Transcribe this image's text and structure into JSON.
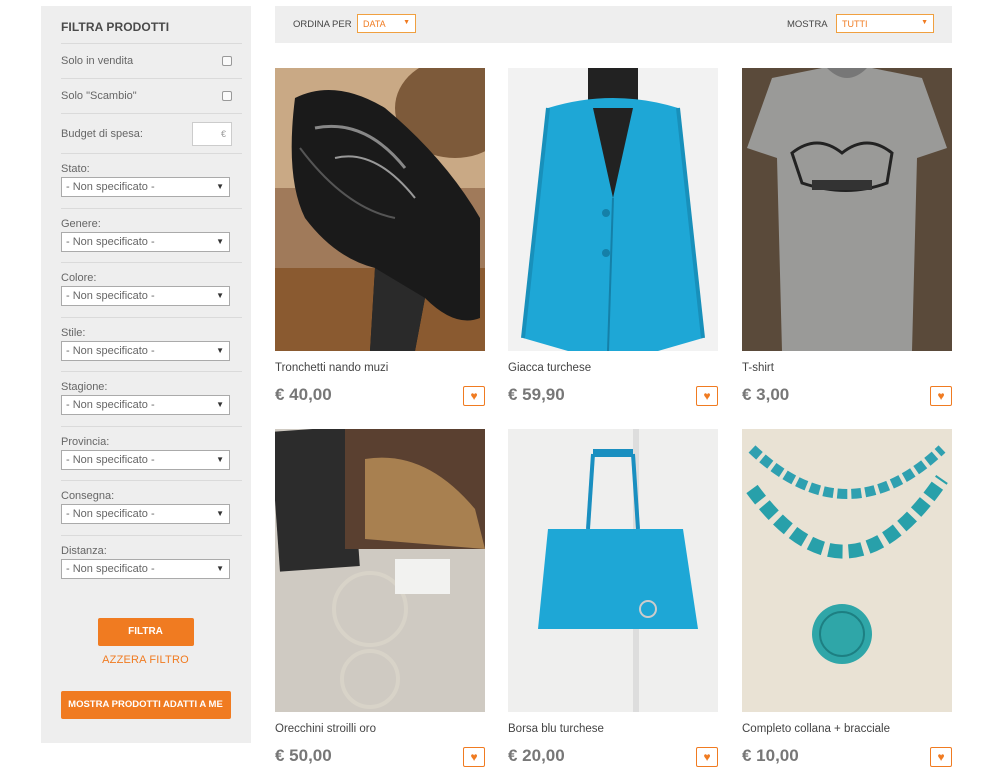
{
  "sidebar": {
    "title": "FILTRA PRODOTTI",
    "only_on_sale": "Solo in vendita",
    "only_swap": "Solo \"Scambio\"",
    "budget_label": "Budget di spesa:",
    "budget_placeholder": "€",
    "filters": [
      {
        "label": "Stato:",
        "value": "- Non specificato -"
      },
      {
        "label": "Genere:",
        "value": "- Non specificato -"
      },
      {
        "label": "Colore:",
        "value": "- Non specificato -"
      },
      {
        "label": "Stile:",
        "value": "- Non specificato -"
      },
      {
        "label": "Stagione:",
        "value": "- Non specificato -"
      },
      {
        "label": "Provincia:",
        "value": "- Non specificato -"
      },
      {
        "label": "Consegna:",
        "value": "- Non specificato -"
      },
      {
        "label": "Distanza:",
        "value": "- Non specificato -"
      }
    ],
    "filter_button": "FILTRA",
    "reset_link": "AZZERA FILTRO",
    "show_matching_button": "MOSTRA PRODOTTI ADATTI A ME"
  },
  "topbar": {
    "sort_label": "ORDINA PER",
    "sort_value": "DATA",
    "show_label": "MOSTRA",
    "show_value": "TUTTI"
  },
  "products": [
    {
      "name": "Tronchetti nando muzi",
      "price": "€ 40,00"
    },
    {
      "name": "Giacca turchese",
      "price": "€ 59,90"
    },
    {
      "name": "T-shirt",
      "price": "€ 3,00"
    },
    {
      "name": "Orecchini stroilli oro",
      "price": "€ 50,00"
    },
    {
      "name": "Borsa blu turchese",
      "price": "€ 20,00"
    },
    {
      "name": "Completo collana + bracciale",
      "price": "€ 10,00"
    }
  ],
  "colors": {
    "accent": "#f07b21",
    "panel": "#eeeeee"
  }
}
